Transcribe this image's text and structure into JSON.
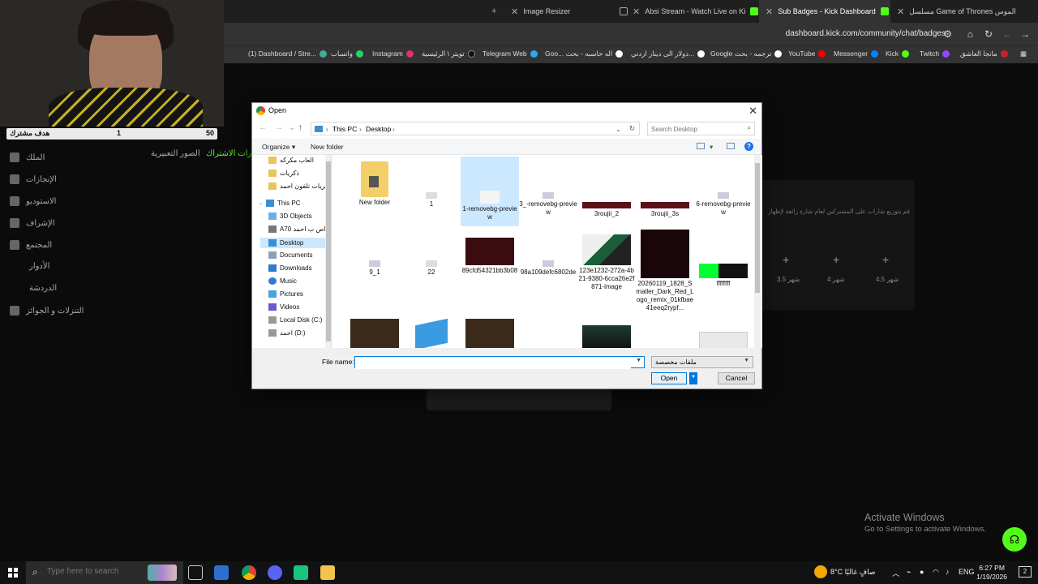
{
  "browser": {
    "tabs": [
      {
        "label": "",
        "icon": "plus-icon"
      },
      {
        "label": "Image Resizer"
      },
      {
        "label": "Absi Stream - Watch Live on Ki"
      },
      {
        "label": "Sub Badges - Kick Dashboard"
      },
      {
        "label": "مسلسل Game of Thrones الموس"
      }
    ],
    "url": "dashboard.kick.com/community/chat/badges",
    "bookmarks": [
      "(1) Dashboard / Stre...",
      "واتساب",
      "Instagram",
      "تويتر \\ الرئيسية",
      "Telegram Web",
      "Goo... اله حاسبه - بحث",
      "دولار الى دينار اردني...",
      "Google ترجمه - بحث",
      "YouTube",
      "Messenger",
      "Kick",
      "Twitch",
      "مانجا العاشق"
    ]
  },
  "webcam": {
    "goal_label": "هدف مشترك",
    "goal_current": "1",
    "goal_target": "50"
  },
  "page": {
    "sidebar": [
      "الملك",
      "الإنجازات",
      "الاستوديو",
      "الإشراف",
      "المجتمع",
      "الأدوار",
      "الدردشة",
      "التنزلات و الجوائز"
    ],
    "tabs": [
      "الصور التعبيرية",
      "شارات الاشتراك"
    ],
    "hint": "قم بتوزيع شارات على المشتركين لعام شارة رائعة لإظهار",
    "tiers": [
      "3.5 شهر",
      "4 شهر",
      "4.5 شهر"
    ]
  },
  "dialog": {
    "title": "Open",
    "path": [
      "This PC",
      "Desktop"
    ],
    "search_placeholder": "Search Desktop",
    "organize": "Organize ▾",
    "new_folder": "New folder",
    "navpane": [
      "العاب مكركه",
      "ذكريات",
      "كريات تلفون احمد",
      "This PC",
      "3D Objects",
      "A70 خاص ب احمد",
      "Desktop",
      "Documents",
      "Downloads",
      "Music",
      "Pictures",
      "Videos",
      "Local Disk (C:)",
      "احمد (D:)"
    ],
    "files": [
      {
        "name": "New folder"
      },
      {
        "name": "1"
      },
      {
        "name": "1-removebg-preview"
      },
      {
        "name": "3_-removebg-preview"
      },
      {
        "name": "3roujii_2"
      },
      {
        "name": "3roujii_3s"
      },
      {
        "name": "6-removebg-preview"
      },
      {
        "name": "9_1"
      },
      {
        "name": "22"
      },
      {
        "name": "89cfd54321bb3b08"
      },
      {
        "name": "98a109defc6802de"
      },
      {
        "name": "123e1232-272a-4b21-9380-6cca26e2f871-image"
      },
      {
        "name": "20260119_1828_Smaller_Dark_Red_Logo_remix_01kfbae41eeq2rypf..."
      },
      {
        "name": "ffffffff"
      }
    ],
    "file_name_label": "File name:",
    "file_name_value": "",
    "file_type": "ملفات مخصصة",
    "open_label": "Open",
    "cancel_label": "Cancel"
  },
  "watermark": {
    "line1": "Activate Windows",
    "line2": "Go to Settings to activate Windows."
  },
  "taskbar": {
    "search_placeholder": "Type here to search",
    "weather": "8°C  صافٍ غالبًا",
    "lang": "ENG",
    "time": "6:27 PM",
    "date": "1/19/2026",
    "notif_count": "2"
  }
}
